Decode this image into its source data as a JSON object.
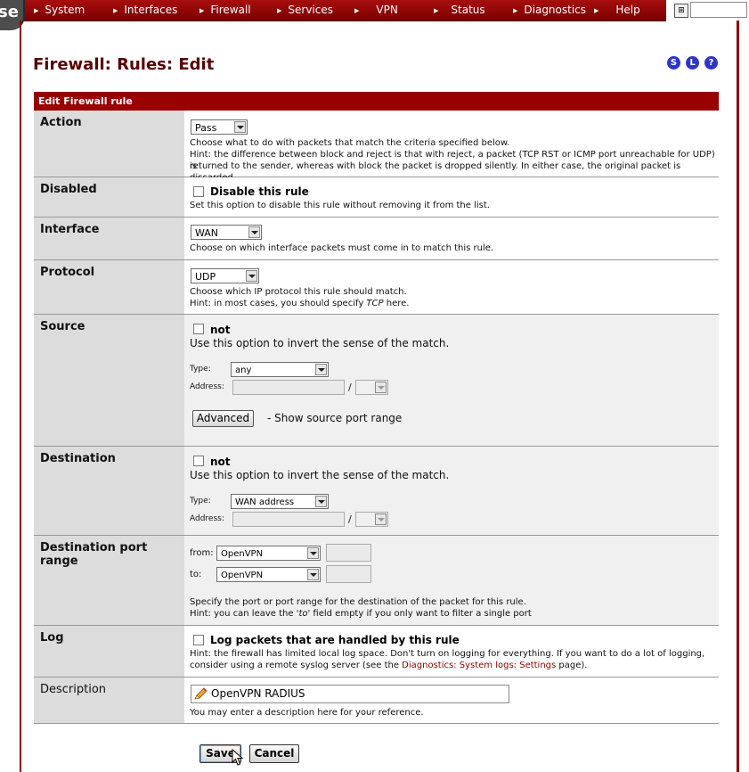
{
  "nav": {
    "logo_text": "se",
    "items": [
      "System",
      "Interfaces",
      "Firewall",
      "Services",
      "VPN",
      "Status",
      "Diagnostics",
      "Help"
    ],
    "network_icon": "network-icon",
    "search_value": ""
  },
  "page": {
    "title": "Firewall: Rules: Edit",
    "quick_icons": [
      "S",
      "L",
      "?"
    ]
  },
  "form": {
    "header": "Edit Firewall rule",
    "action": {
      "label": "Action",
      "value": "Pass",
      "hint1": "Choose what to do with packets that match the criteria specified below.",
      "hint2": "Hint: the difference between block and reject is that with reject, a packet (TCP RST or ICMP port unreachable for UDP) is",
      "hint3": "returned to the sender, whereas with block the packet is dropped silently. In either case, the original packet is discarded."
    },
    "disabled": {
      "label": "Disabled",
      "checkbox_label": "Disable this rule",
      "checked": false,
      "hint": "Set this option to disable this rule without removing it from the list."
    },
    "interface": {
      "label": "Interface",
      "value": "WAN",
      "hint": "Choose on which interface packets must come in to match this rule."
    },
    "protocol": {
      "label": "Protocol",
      "value": "UDP",
      "hint1": "Choose which IP protocol this rule should match.",
      "hint2_prefix": "Hint: in most cases, you should specify ",
      "hint2_em": "TCP",
      "hint2_suffix": " here."
    },
    "source": {
      "label": "Source",
      "not_label": "not",
      "not_checked": false,
      "hint": "Use this option to invert the sense of the match.",
      "type_label": "Type:",
      "type_value": "any",
      "address_label": "Address:",
      "address_value": "",
      "slash": "/",
      "advanced_button": "Advanced",
      "advanced_text": "- Show source port range"
    },
    "destination": {
      "label": "Destination",
      "not_label": "not",
      "not_checked": false,
      "hint": "Use this option to invert the sense of the match.",
      "type_label": "Type:",
      "type_value": "WAN address",
      "address_label": "Address:",
      "address_value": "",
      "slash": "/"
    },
    "dest_port": {
      "label": "Destination port range",
      "from_label": "from:",
      "from_value": "OpenVPN",
      "from_custom": "",
      "to_label": "to:",
      "to_value": "OpenVPN",
      "to_custom": "",
      "hint1": "Specify the port or port range for the destination of the packet for this rule.",
      "hint2_prefix": "Hint: you can leave the ",
      "hint2_em": "'to'",
      "hint2_suffix": " field empty if you only want to filter a single port"
    },
    "log": {
      "label": "Log",
      "checkbox_label": "Log packets that are handled by this rule",
      "checked": false,
      "hint1": "Hint: the firewall has limited local log space. Don't turn on logging for everything. If you want to do a lot of logging,",
      "hint2_prefix": "consider using a remote syslog server (see the ",
      "hint2_link": "Diagnostics: System logs: Settings",
      "hint2_suffix": " page)."
    },
    "description": {
      "label": "Description",
      "value": "OpenVPN RADIUS",
      "hint": "You may enter a description here for your reference."
    },
    "buttons": {
      "save": "Save",
      "cancel": "Cancel"
    }
  },
  "colors": {
    "brand_red": "#990000",
    "title_red": "#5a0000",
    "label_bg": "#dcdcdc",
    "quick_icon_blue": "#2d36c8"
  }
}
